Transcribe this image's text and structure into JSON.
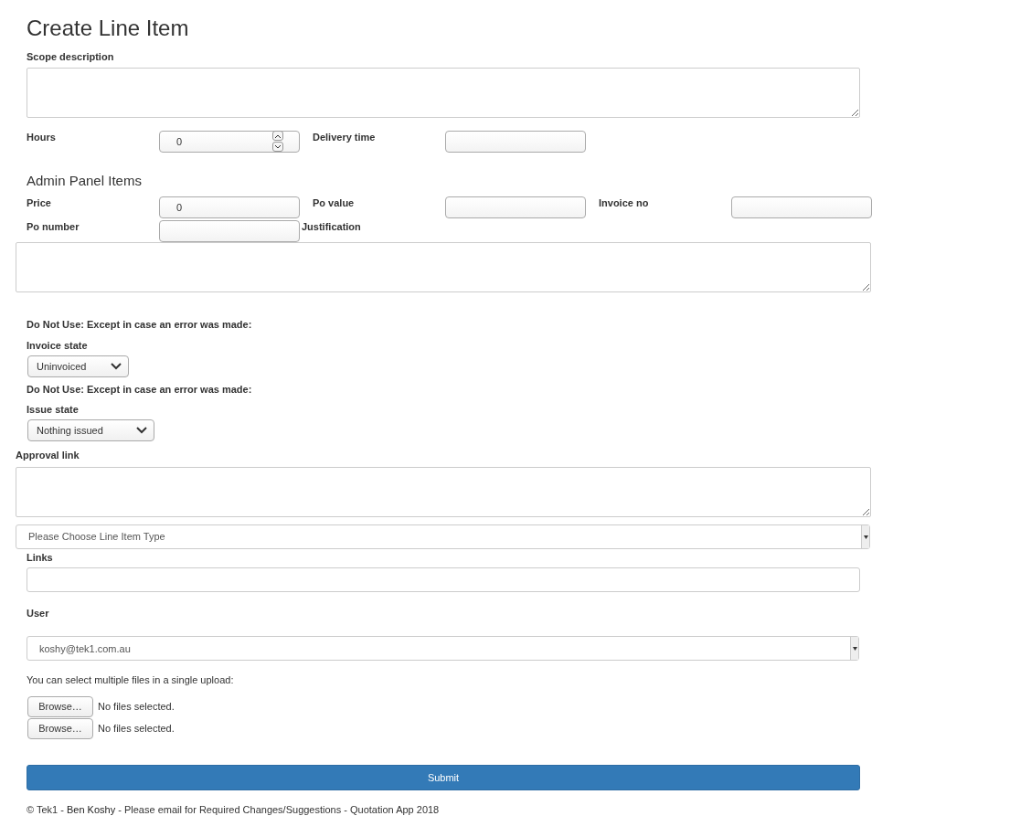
{
  "title": "Create Line Item",
  "scope_label": "Scope description",
  "hours": {
    "label": "Hours",
    "value": "0"
  },
  "delivery_time": {
    "label": "Delivery time"
  },
  "admin_heading": "Admin Panel Items",
  "price": {
    "label": "Price",
    "value": "0"
  },
  "po_value": {
    "label": "Po value"
  },
  "invoice_no": {
    "label": "Invoice no"
  },
  "po_number": {
    "label": "Po number"
  },
  "justification_label": "Justification",
  "invoice_warning": "Do Not Use: Except in case an error was made:",
  "invoice_state": {
    "label": "Invoice state",
    "value": "Uninvoiced"
  },
  "issue_warning": "Do Not Use: Except in case an error was made:",
  "issue_state": {
    "label": "Issue state",
    "value": "Nothing issued"
  },
  "approval_label": "Approval link",
  "line_item_type": {
    "value": "Please Choose Line Item Type"
  },
  "links_label": "Links",
  "user": {
    "label": "User",
    "value": "koshy@tek1.com.au"
  },
  "upload_note": "You can select multiple files in a single upload:",
  "files": [
    {
      "button": "Browse…",
      "status": "No files selected."
    },
    {
      "button": "Browse…",
      "status": "No files selected."
    }
  ],
  "submit": "Submit",
  "footer": {
    "prefix": "© Tek1 - ",
    "link": "Ben Koshy",
    "suffix": " - Please email for Required Changes/Suggestions - Quotation App 2018"
  }
}
